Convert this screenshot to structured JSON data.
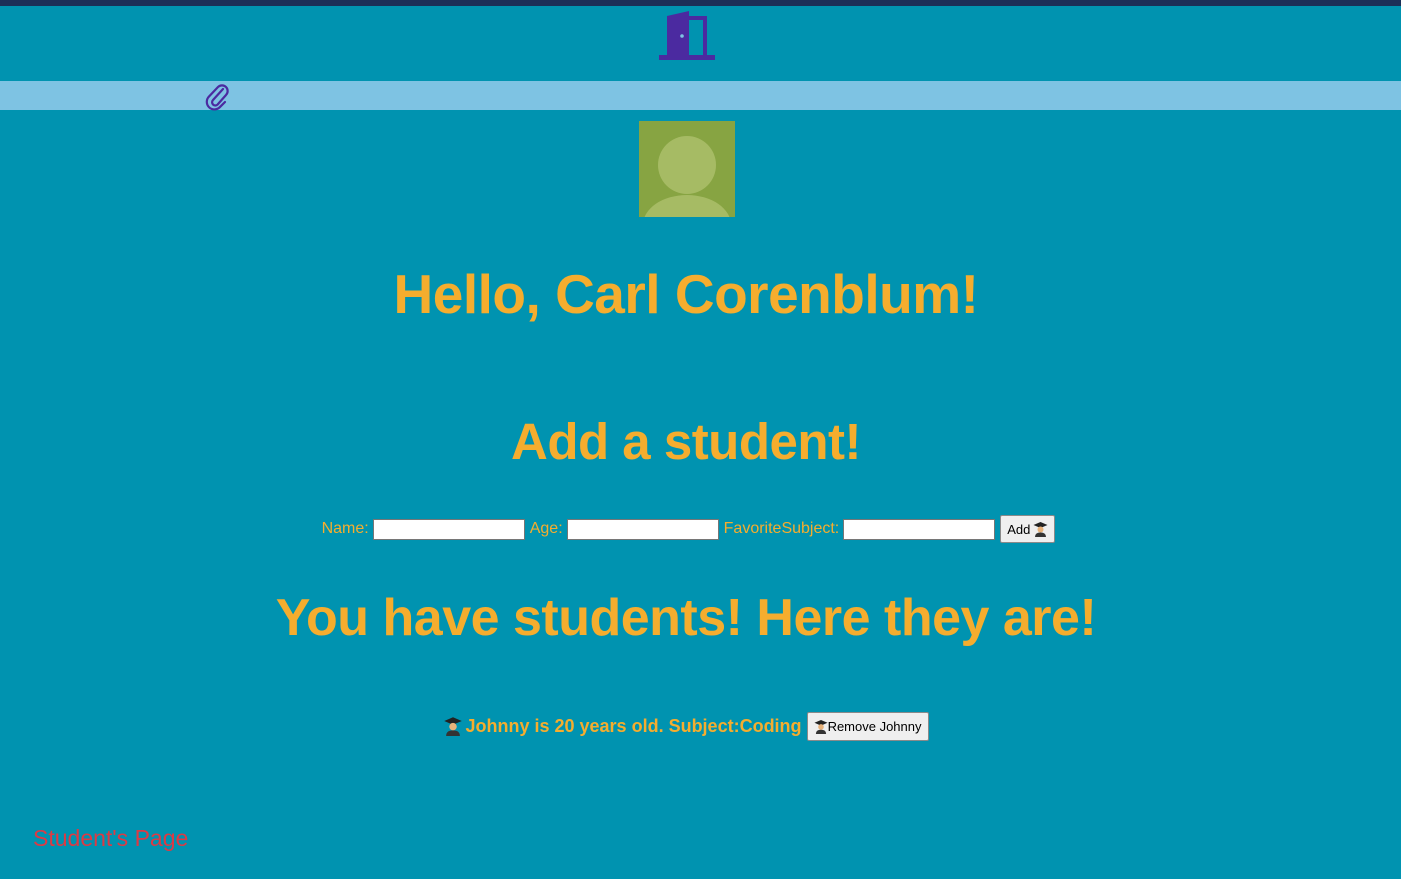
{
  "header": {
    "logout_icon": "door-icon",
    "icon_color": "#4b2aa0",
    "background": "#0093b0",
    "top_strip_color": "#1c2f57"
  },
  "subbar": {
    "attachment_icon": "paperclip-icon",
    "background": "#7ec3e3"
  },
  "profile": {
    "avatar_icon": "user-avatar-icon",
    "greeting": "Hello, Carl Corenblum!"
  },
  "add_form": {
    "title": "Add a student!",
    "name_label": "Name:",
    "name_value": "",
    "age_label": "Age:",
    "age_value": "",
    "subject_label": "FavoriteSubject:",
    "subject_value": "",
    "add_button_label": "Add",
    "add_button_icon": "student-icon"
  },
  "students_section": {
    "title": "You have students! Here they are!",
    "students": [
      {
        "icon": "student-icon",
        "text": "Johnny is 20 years old. Subject:Coding",
        "remove_label": "Remove Johnny"
      }
    ]
  },
  "footer": {
    "link_text": "Student's Page",
    "link_color": "#dc3a44"
  },
  "colors": {
    "accent_text": "#f5ad2e",
    "page_background": "#0093b0"
  }
}
